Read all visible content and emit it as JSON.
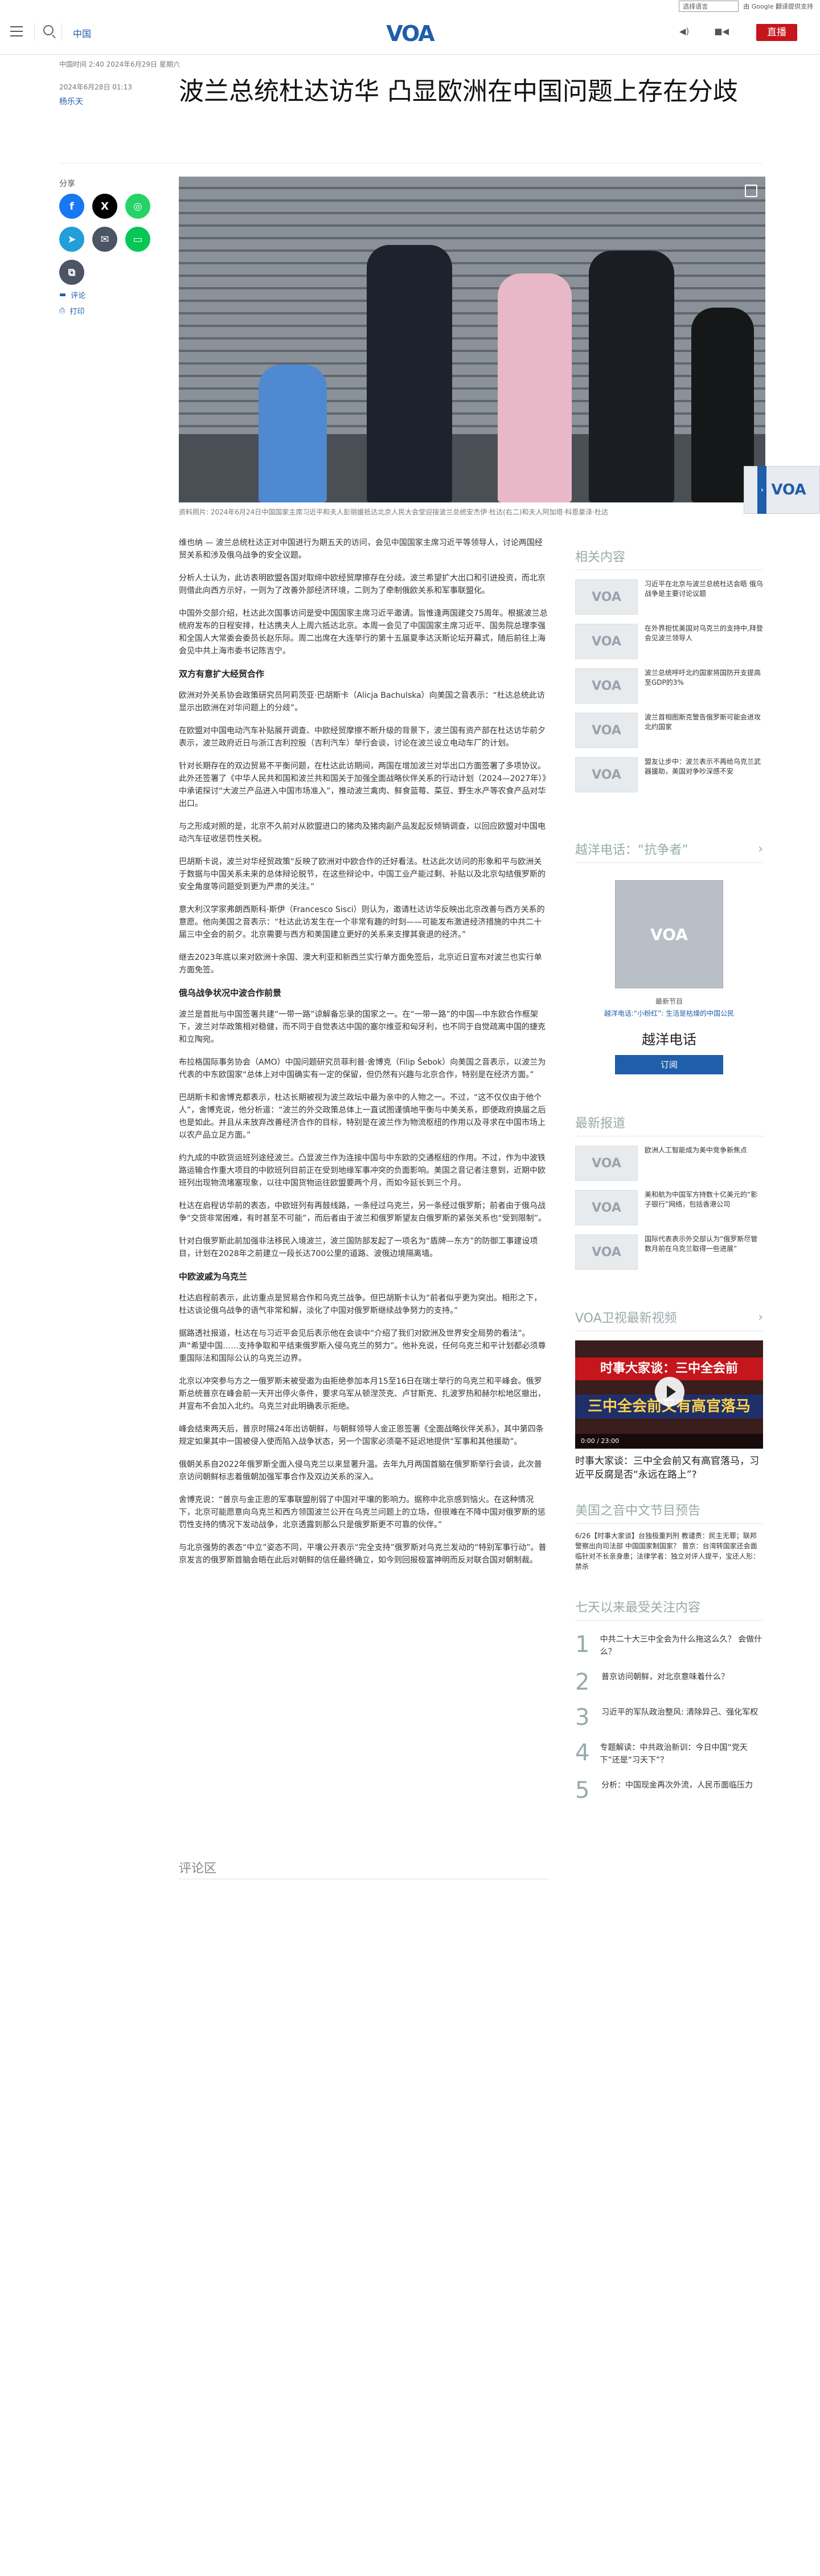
{
  "top_bar": {
    "language_select": "选择语言",
    "powered_by": "由 Google 翻译提供支持"
  },
  "header": {
    "section": "中国",
    "logo_text": "VOA",
    "live_label": "直播"
  },
  "article": {
    "meta": "中国时间 2:40 2024年6月29日 星期六",
    "updated": "2024年6月28日 01:13",
    "author": "杨乐天",
    "title": "波兰总统杜达访华 凸显欧洲在中国问题上存在分歧",
    "share_label": "分享",
    "comment_link": "评论",
    "print_link": "打印",
    "caption": "资料照片: 2024年6月24日中国国家主席习近平和夫人彭丽媛抵达北京人民大会堂迎接波兰总统安杰伊·杜达(右二)和夫人阿加塔·科恩豪泽·杜达",
    "paragraphs": [
      "维也纳 — 波兰总统杜达正对中国进行为期五天的访问，会见中国国家主席习近平等领导人，讨论两国经贸关系和涉及俄乌战争的安全议题。",
      "分析人士认为，此访表明欧盟各国对取缔中欧经贸摩擦存在分歧。波兰希望扩大出口和引进投资，而北京则借此向西方示好，一则为了改善外部经济环境，二则为了牵制俄欧关系和军事联盟化。",
      "中国外交部介绍，杜达此次国事访问是受中国国家主席习近平邀请。旨惟逢两国建交75周年。根据波兰总统府发布的日程安排，杜达携夫人上周六抵达北京。本周一会见了中国国家主席习近平、国务院总理李强和全国人大常委会委员长赵乐际。周二出席在大连举行的第十五届夏季达沃斯论坛开幕式，随后前往上海会见中共上海市委书记陈吉宁。"
    ],
    "h1": "双方有意扩大经贸合作",
    "paragraphs2": [
      "欧洲对外关系协会政策研究员阿莉茨亚·巴胡斯卡（Alicja Bachulska）向美国之音表示：“杜达总统此访显示出欧洲在对华问题上的分歧”。",
      "在欧盟对中国电动汽车补贴展开调查、中欧经贸摩擦不断升级的背景下，波兰国有资产部在杜达访华前夕表示，波兰政府近日与浙江吉利控股（吉利汽车）举行会谈，讨论在波兰设立电动车厂的计划。",
      "针对长期存在的双边贸易不平衡问题，在杜达此访期间，两国在增加波兰对华出口方面签署了多项协议。此外还签署了《中华人民共和国和波兰共和国关于加强全面战略伙伴关系的行动计划（2024—2027年）》中承诺探讨“大波兰产品进入中国市场准入”，推动波兰禽肉、鲜食蓝莓、菜豆、野生水产等农食产品对华出口。",
      "与之形成对照的是，北京不久前对从欧盟进口的猪肉及猪肉副产品发起反倾销调查，以回应欧盟对中国电动汽车征收惩罚性关税。",
      "巴胡斯卡说，波兰对华经贸政策“反映了欧洲对中欧合作的迁好看法。杜达此次访问的形象和平与欧洲关于数据与中国关系未来的总体辩论脱节，在这些辩论中，中国工业产能过剩、补贴以及北京勾结俄罗斯的安全角度等问题受到更为严肃的关注。”",
      "意大利汉学家弗朗西斯科·斯伊（Francesco Sisci）则认为，邀请杜达访华反映出北京改善与西方关系的意愿。他向美国之音表示：“杜达此访发生在一个非常有趣的时刻——可能发布激进经济措施的中共二十届三中全会的前夕。北京需要与西方和美国建立更好的关系来支撑其衰退的经济。”",
      "继去2023年底以来对欧洲十余国、澳大利亚和新西兰实行单方面免签后，北京近日宣布对波兰也实行单方面免签。"
    ],
    "h2": "俄乌战争状况中波合作前景",
    "paragraphs3": [
      "波兰是首批与中国签署共建“一带一路”谅解备忘录的国家之一。在“一带一路”的中国—中东欧合作框架下，波兰对华政策相对稳健，而不同于自觉表达中国的塞尔维亚和匈牙利，也不同于自觉疏离中国的捷克和立陶宛。",
      "布拉格国际事务协会（AMO）中国问题研究员菲利普·舍博克（Filip Šebok）向美国之音表示，以波兰为代表的中东欧国家“总体上对中国确实有一定的保留，但仍然有兴趣与北京合作，特别是在经济方面。”",
      "巴胡斯卡和舍博克都表示，杜达长期被视为波兰政坛中最为亲中的人物之一。不过，“这不仅仅由于他个人”，舍博克说，他分析道：“波兰的外交政策总体上一直试图谨慎地平衡与中美关系，即便政府换届之后也是如此。并且从未放弃改善经济合作的目标，特别是在波兰作为物流枢纽的作用以及寻求在中国市场上以农产品立足方面。”",
      "约九成的中欧货运班列途经波兰。凸显波兰作为连接中国与中东欧的交通枢纽的作用。不过，作为中波铁路运输合作重大项目的中欧班列目前正在受到地缘军事冲突的负面影响。美国之音记者注意到，近期中欧班列出现物流堵塞现象，以往中国货物运往欧盟要两个月，而如今延长到三个月。",
      "杜达在启程访华前的表态，中欧班列有再鼓线路，一条经过乌克兰，另一条经过俄罗斯；前者由于俄乌战争“交货非常困难，有时甚至不可能”，而后者由于波兰和俄罗斯望友白俄罗斯的紧张关系也“受到限制”。",
      "针对白俄罗斯此前加强非法移民入境波兰，波兰国防部发起了一项名为“盾牌—东方”的防御工事建设项目，计划在2028年之前建立一段长达700公里的道路、波俄边境隔离墙。"
    ],
    "h3": "中欧波戚为乌克兰",
    "paragraphs4": [
      "杜达启程前表示，此访重点是贸易合作和乌克兰战争。但巴胡斯卡认为“前者似乎更为突出。相形之下，杜达谈论俄乌战争的语气非常和解，淡化了中国对俄罗斯继续战争努力的支持。”",
      "据路透社报道，杜达在与习近平会见后表示他在会谈中“介绍了我们对欧洲及世界安全局势的看法”。声“希望中国……支持争取和平结束俄罗斯入侵乌克兰的努力”。他补充说，任何乌克兰和平计划都必须尊重国际法和国际公认的乌克兰边界。",
      "北京以冲突参与方之一俄罗斯未被受邀为由拒绝参加本月15至16日在瑞士举行的乌克兰和平峰会。俄罗斯总统普京在峰会前一天开出停火条件，要求乌军从顿涅茨克、卢甘斯克、扎波罗热和赫尔松地区撤出，并宣布不会加入北约。乌克兰对此明确表示拒绝。",
      "峰会结束两天后，普京时隔24年出访朝鲜，与朝鲜领导人金正恩签署《全面战略伙伴关系》，其中第四条规定如果其中一国被侵入使而陷入战争状态，另一个国家必须毫不延迟地提供“军事和其他援助”。",
      "俄朝关系自2022年俄罗斯全面入侵乌克兰以来显著升温。去年九月两国首脑在俄罗斯举行会谈，此次普京访问朝鲜标志着俄朝加强军事合作及双边关系的深入。",
      "舍博克说：“普京与金正恩的军事联盟削弱了中国对平壤的影响力。据称中北京感到恼火。在这种情况下，北京可能愿意向乌克兰和西方领国波兰公开在乌克兰问题上的立场，但很难在不降中国对俄罗斯的惩罚性支持的情况下发动战争，北京透露到那么只是俄罗斯更不可靠的伙伴。”",
      "与北京强势的表态“中立”姿态不同，平壤公开表示“完全支持”俄罗斯对乌克兰发动的“特别军事行动”。普京发言的俄罗斯首脑会晤在此后对朝鲜的信任最终确立，如今则回报极富神明而反对联合国对朝制裁。"
    ],
    "comments_heading": "评论区"
  },
  "rail": {
    "related_heading": "相关内容",
    "related": [
      "习近平在北京与波兰总统杜达会晤 俄乌战争是主要讨论议题",
      "在外界担忧美国对乌克兰的支持中,拜登会见波兰领导人",
      "波兰总统呼吁北约国家将国防开支提高至GDP的3%",
      "波兰首相图斯克警告俄罗斯可能会进攻北约国家",
      "盟友让步中：波兰表示不再给乌克兰武器援助，美国对争吵深感不安"
    ],
    "podcast_heading": "越洋电话：“抗争者”",
    "podcast_kicker": "最新节目",
    "podcast_desc": "越洋电话:“小粉红”: 生活是枯燥的中国公民",
    "podcast_title": "越洋电话",
    "subscribe": "订阅",
    "latest_heading": "最新报道",
    "latest": [
      "欧洲人工智能成为美中竞争新焦点",
      "美和航为中国军方持数十亿美元的“影子银行”网络，包括香港公司",
      "国际代表表示外交部认为“俄罗斯尽管数月前在乌克兰取得一些进展”"
    ],
    "video_heading": "VOA卫视最新视频",
    "video_band": "时事大家谈：三中全会前",
    "video_band2": "三中全会前又有高官落马",
    "video_time": "0:00 / 23:00",
    "video_caption": "时事大家谈：三中全会前又有高官落马，习近平反腐是否“永远在路上”?",
    "preview_heading": "美国之音中文节目预告",
    "preview_text": "6/26【时事大家谈】台独极重判刑 教谴责：民主无罪；联邦警察出向司法部 中国国家制国家？ 普京：台湾转国家还会面临针对不长亲身患；法律学者：独立对评人提平，宝还人形： 禁杀",
    "popular_heading": "七天以来最受关注内容",
    "popular": [
      "中共二十大三中全会为什么拖这么久？ 会做什么？",
      "普京访问朝鲜，对北京意味着什么？",
      "习近平的军队政治整风: 清除异己、强化军权",
      "专题解读：中共政治新训：今日中国“党天下”还是“习天下”？",
      "分析：中国现金再次外流，人民币面临压力"
    ]
  },
  "colors": {
    "brand": "#1f5eaa",
    "live": "#c4161c",
    "facebook": "#1877f2",
    "x": "#000000",
    "whatsapp": "#25d366",
    "telegram": "#229ed9",
    "email": "#4b5563",
    "line": "#06c755"
  }
}
